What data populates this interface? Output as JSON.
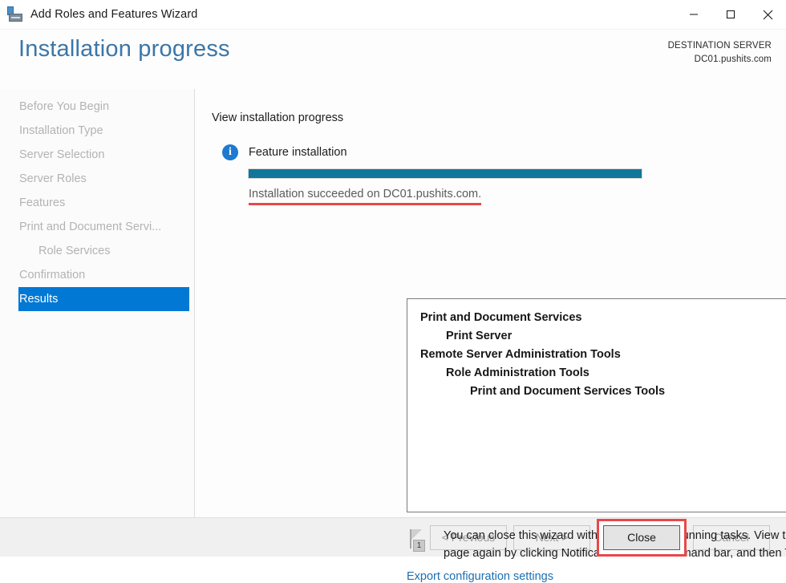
{
  "window": {
    "title": "Add Roles and Features Wizard",
    "icon": "server-roles-icon",
    "controls": {
      "minimize": "minimize-icon",
      "maximize": "maximize-icon",
      "close": "close-icon"
    }
  },
  "header": {
    "page_title": "Installation progress",
    "destination_label": "DESTINATION SERVER",
    "destination_server": "DC01.pushits.com"
  },
  "sidebar": {
    "items": [
      {
        "label": "Before You Begin",
        "level": 0,
        "active": false
      },
      {
        "label": "Installation Type",
        "level": 0,
        "active": false
      },
      {
        "label": "Server Selection",
        "level": 0,
        "active": false
      },
      {
        "label": "Server Roles",
        "level": 0,
        "active": false
      },
      {
        "label": "Features",
        "level": 0,
        "active": false
      },
      {
        "label": "Print and Document Servi...",
        "level": 0,
        "active": false
      },
      {
        "label": "Role Services",
        "level": 1,
        "active": false
      },
      {
        "label": "Confirmation",
        "level": 0,
        "active": false
      },
      {
        "label": "Results",
        "level": 0,
        "active": true
      }
    ]
  },
  "main": {
    "section_title": "View installation progress",
    "feature_label": "Feature installation",
    "progress": {
      "percent": 100,
      "fill_color": "#11769a"
    },
    "status_text": "Installation succeeded on DC01.pushits.com.",
    "status_underline_color": "#e8484a",
    "results": [
      {
        "label": "Print and Document Services",
        "level": 1
      },
      {
        "label": "Print Server",
        "level": 2
      },
      {
        "label": "Remote Server Administration Tools",
        "level": 1
      },
      {
        "label": "Role Administration Tools",
        "level": 2
      },
      {
        "label": "Print and Document Services Tools",
        "level": 3
      }
    ],
    "note_text": "You can close this wizard without interrupting running tasks. View task progress or open this page again by clicking Notifications in the command bar, and then Task Details.",
    "note_badge_count": "1",
    "export_link": "Export configuration settings"
  },
  "footer": {
    "buttons": [
      {
        "label": "< Previous",
        "enabled": false,
        "annotated": false
      },
      {
        "label": "Next >",
        "enabled": false,
        "annotated": false
      },
      {
        "label": "Close",
        "enabled": true,
        "annotated": true
      },
      {
        "label": "Cancel",
        "enabled": false,
        "annotated": false
      }
    ],
    "annotation_color": "#e8484a"
  }
}
